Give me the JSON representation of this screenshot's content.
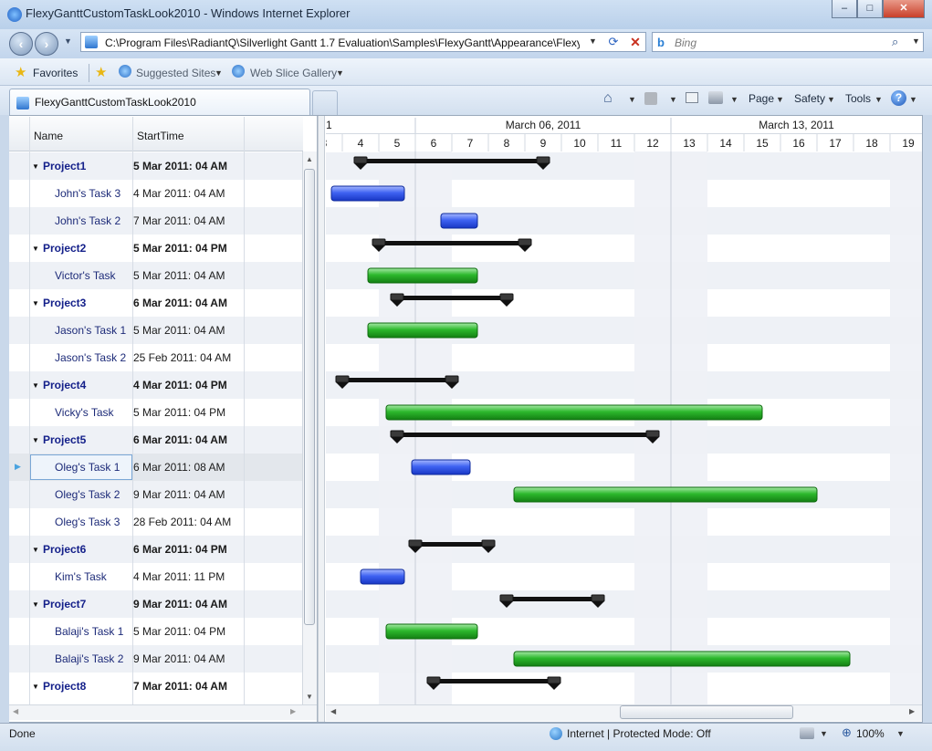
{
  "window": {
    "title": "FlexyGanttCustomTaskLook2010 - Windows Internet Explorer",
    "minimize": "–",
    "maximize": "□",
    "close": "✕"
  },
  "nav": {
    "address": "C:\\Program Files\\RadiantQ\\Silverlight Gantt 1.7  Evaluation\\Samples\\FlexyGantt\\Appearance\\FlexyC",
    "search_placeholder": "Bing"
  },
  "favorites": {
    "favorites_label": "Favorites",
    "suggested_sites_label": "Suggested Sites",
    "web_slice_gallery_label": "Web Slice Gallery"
  },
  "tab": {
    "title": "FlexyGanttCustomTaskLook2010"
  },
  "commands": {
    "page_label": "Page",
    "safety_label": "Safety",
    "tools_label": "Tools"
  },
  "grid": {
    "columns": [
      "Name",
      "StartTime"
    ],
    "rows": [
      {
        "name": "Project1",
        "start": "5 Mar 2011: 04 AM",
        "kind": "project"
      },
      {
        "name": "John's Task 3",
        "start": "4 Mar 2011: 04 AM",
        "kind": "task"
      },
      {
        "name": "John's Task 2",
        "start": "7 Mar 2011: 04 AM",
        "kind": "task"
      },
      {
        "name": "Project2",
        "start": "5 Mar 2011: 04 PM",
        "kind": "project"
      },
      {
        "name": "Victor's Task",
        "start": "5 Mar 2011: 04 AM",
        "kind": "task"
      },
      {
        "name": "Project3",
        "start": "6 Mar 2011: 04 AM",
        "kind": "project"
      },
      {
        "name": "Jason's Task 1",
        "start": "5 Mar 2011: 04 AM",
        "kind": "task"
      },
      {
        "name": "Jason's Task 2",
        "start": "25 Feb 2011: 04 AM",
        "kind": "task"
      },
      {
        "name": "Project4",
        "start": "4 Mar 2011: 04 PM",
        "kind": "project"
      },
      {
        "name": "Vicky's Task",
        "start": "5 Mar 2011: 04 PM",
        "kind": "task"
      },
      {
        "name": "Project5",
        "start": "6 Mar 2011: 04 AM",
        "kind": "project"
      },
      {
        "name": "Oleg's Task 1",
        "start": "6 Mar 2011: 08 AM",
        "kind": "task",
        "selected": true
      },
      {
        "name": "Oleg's Task 2",
        "start": "9 Mar 2011: 04 AM",
        "kind": "task"
      },
      {
        "name": "Oleg's Task 3",
        "start": "28 Feb 2011: 04 AM",
        "kind": "task"
      },
      {
        "name": "Project6",
        "start": "6 Mar 2011: 04 PM",
        "kind": "project"
      },
      {
        "name": "Kim's Task",
        "start": "4 Mar 2011: 11 PM",
        "kind": "task"
      },
      {
        "name": "Project7",
        "start": "9 Mar 2011: 04 AM",
        "kind": "project"
      },
      {
        "name": "Balaji's Task 1",
        "start": "5 Mar 2011: 04 PM",
        "kind": "task"
      },
      {
        "name": "Balaji's Task 2",
        "start": "9 Mar 2011: 04 AM",
        "kind": "task"
      },
      {
        "name": "Project8",
        "start": "7 Mar 2011: 04 AM",
        "kind": "project"
      }
    ]
  },
  "timeline": {
    "weeks": [
      "1",
      "March 06, 2011",
      "March 13, 2011"
    ],
    "days": [
      "3",
      "4",
      "5",
      "6",
      "7",
      "8",
      "9",
      "10",
      "11",
      "12",
      "13",
      "14",
      "15",
      "16",
      "17",
      "18",
      "19"
    ]
  },
  "gantt": {
    "colors": {
      "blue": "#2a4fe0",
      "green": "#1fa51f",
      "summary": "#111111",
      "weekend": "#eef1f6"
    },
    "bars": [
      {
        "row": 0,
        "type": "summary",
        "start": 4.5,
        "end": 9.5
      },
      {
        "row": 1,
        "type": "blue",
        "start": 3.7,
        "end": 5.7
      },
      {
        "row": 2,
        "type": "blue",
        "start": 6.7,
        "end": 7.7
      },
      {
        "row": 3,
        "type": "summary",
        "start": 5.0,
        "end": 9.0
      },
      {
        "row": 4,
        "type": "green",
        "start": 4.7,
        "end": 7.7
      },
      {
        "row": 5,
        "type": "summary",
        "start": 5.5,
        "end": 8.5
      },
      {
        "row": 6,
        "type": "green",
        "start": 4.7,
        "end": 7.7
      },
      {
        "row": 8,
        "type": "summary",
        "start": 4.0,
        "end": 7.0
      },
      {
        "row": 9,
        "type": "green",
        "start": 5.2,
        "end": 15.5
      },
      {
        "row": 10,
        "type": "summary",
        "start": 5.5,
        "end": 12.5
      },
      {
        "row": 11,
        "type": "blue",
        "start": 5.9,
        "end": 7.5
      },
      {
        "row": 12,
        "type": "green",
        "start": 8.7,
        "end": 17.0
      },
      {
        "row": 14,
        "type": "summary",
        "start": 6.0,
        "end": 8.0
      },
      {
        "row": 15,
        "type": "blue",
        "start": 4.5,
        "end": 5.7
      },
      {
        "row": 16,
        "type": "summary",
        "start": 8.5,
        "end": 11.0
      },
      {
        "row": 17,
        "type": "green",
        "start": 5.2,
        "end": 7.7
      },
      {
        "row": 18,
        "type": "green",
        "start": 8.7,
        "end": 17.9
      },
      {
        "row": 19,
        "type": "summary",
        "start": 6.5,
        "end": 9.8
      }
    ]
  },
  "status": {
    "left": "Done",
    "zone": "Internet | Protected Mode: Off",
    "zoom": "100%"
  }
}
